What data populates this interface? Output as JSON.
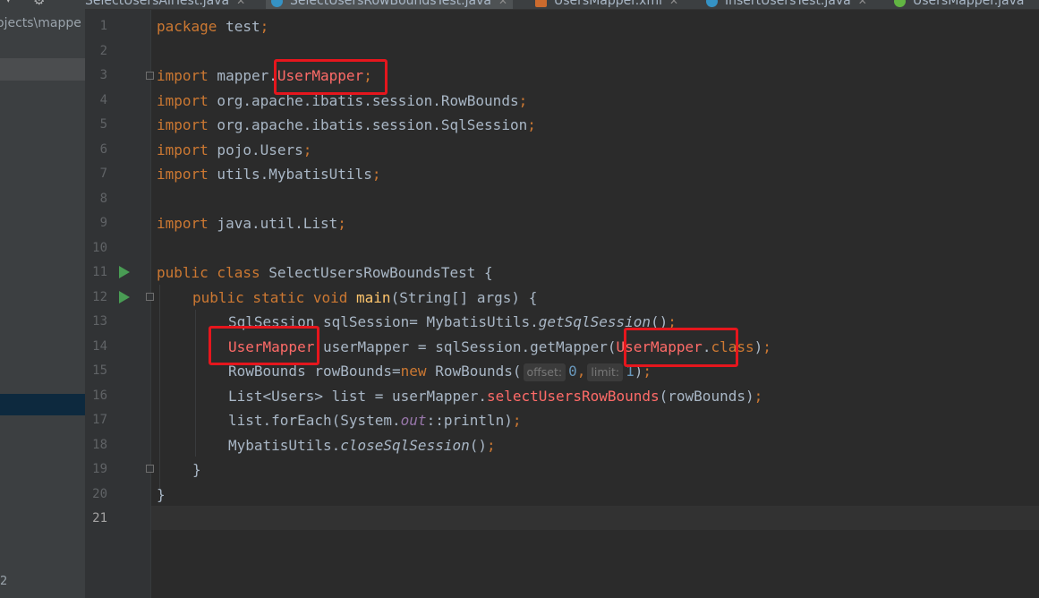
{
  "tabs": [
    {
      "label": "SelectUsersAllTest.java",
      "icon": "java-class-icon",
      "active": false
    },
    {
      "label": "SelectUsersRowBoundsTest.java",
      "icon": "java-class-icon",
      "active": true
    },
    {
      "label": "UsersMapper.xml",
      "icon": "xml-file-icon",
      "active": false
    },
    {
      "label": "InsertUsersTest.java",
      "icon": "java-class-icon",
      "active": false
    },
    {
      "label": "UsersMapper.java",
      "icon": "interface-icon",
      "active": false
    }
  ],
  "project_panel": {
    "path_text": "ojects\\mappe",
    "bottom_text": "2"
  },
  "editor": {
    "current_line": 21,
    "run_lines": [
      11,
      12
    ],
    "line_numbers": [
      "1",
      "2",
      "3",
      "4",
      "5",
      "6",
      "7",
      "8",
      "9",
      "10",
      "11",
      "12",
      "13",
      "14",
      "15",
      "16",
      "17",
      "18",
      "19",
      "20",
      "21"
    ],
    "code": {
      "l1_kw": "package",
      "l1_rest": " test",
      "l1_semi": ";",
      "l3_kw": "import",
      "l3_pkg": " mapper.",
      "l3_cls": "UserMapper",
      "l3_semi": ";",
      "l4_kw": "import",
      "l4_rest": " org.apache.ibatis.session.RowBounds",
      "l4_semi": ";",
      "l5_kw": "import",
      "l5_rest": " org.apache.ibatis.session.SqlSession",
      "l5_semi": ";",
      "l6_kw": "import",
      "l6_rest": " pojo.Users",
      "l6_semi": ";",
      "l7_kw": "import",
      "l7_rest": " utils.MybatisUtils",
      "l7_semi": ";",
      "l9_kw": "import",
      "l9_rest": " java.util.List",
      "l9_semi": ";",
      "l11_kw": "public class",
      "l11_rest": " SelectUsersRowBoundsTest {",
      "l12_kw": "public static void",
      "l12_fn": " main",
      "l12_rest": "(String[] args) {",
      "l13_a": "SqlSession sqlSession= MybatisUtils.",
      "l13_call": "getSqlSession",
      "l13_b": "()",
      "l13_semi": ";",
      "l14_type": "UserMapper",
      "l14_a": " userMapper = sqlSession.getMapper(",
      "l14_cls": "UserMapper",
      "l14_b": ".",
      "l14_kw": "class",
      "l14_c": ")",
      "l14_semi": ";",
      "l15_a": "RowBounds rowBounds=",
      "l15_kw": "new",
      "l15_b": " RowBounds(",
      "l15_hint1": "offset:",
      "l15_n1": "0",
      "l15_comma": ",",
      "l15_hint2": "limit:",
      "l15_n2": "1",
      "l15_c": ")",
      "l15_semi": ";",
      "l16_a": "List<Users> list = userMapper.",
      "l16_call": "selectUsersRowBounds",
      "l16_b": "(rowBounds)",
      "l16_semi": ";",
      "l17_a": "list.forEach(System.",
      "l17_field": "out",
      "l17_b": "::println)",
      "l17_semi": ";",
      "l18_a": "MybatisUtils.",
      "l18_call": "closeSqlSession",
      "l18_b": "()",
      "l18_semi": ";",
      "l19": "}",
      "l20": "}"
    }
  },
  "colors": {
    "editor_bg": "#2b2b2b",
    "keyword": "#cc7832",
    "unresolved": "#ff6b68",
    "number": "#6897bb",
    "annotation_box": "#e5161d"
  }
}
